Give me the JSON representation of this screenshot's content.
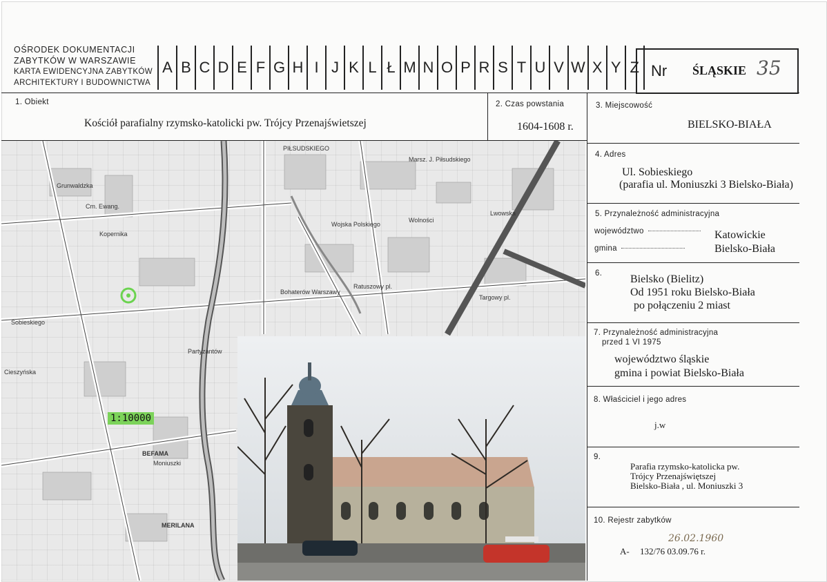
{
  "header": {
    "institution_lines": [
      "OŚRODEK DOKUMENTACJI",
      "ZABYTKÓW W WARSZAWIE",
      "KARTA EWIDENCYJNA ZABYTKÓW",
      "ARCHITEKTURY I BUDOWNICTWA"
    ],
    "letters": [
      "A",
      "B",
      "C",
      "D",
      "E",
      "F",
      "G",
      "H",
      "I",
      "J",
      "K",
      "L",
      "Ł",
      "M",
      "N",
      "O",
      "P",
      "R",
      "S",
      "T",
      "U",
      "V",
      "W",
      "X",
      "Y",
      "Z"
    ],
    "nr_label": "Nr",
    "register": "ŚLĄSKIE",
    "number": "35"
  },
  "fields": {
    "obiekt_label": "1. Obiekt",
    "obiekt_value": "Kościół parafialny rzymsko-katolicki pw. Trójcy Przenajświetszej",
    "czas_label": "2. Czas powstania",
    "czas_value": "1604-1608 r.",
    "miejscowosc_label": "3. Miejscowość",
    "miejscowosc_value": "BIELSKO-BIAŁA",
    "adres_label": "4. Adres",
    "adres_line1": "Ul. Sobieskiego",
    "adres_line2": "(parafia ul. Moniuszki 3 Bielsko-Biała)",
    "przynaleznosc_label": "5. Przynależność administracyjna",
    "wojewodztwo_label": "województwo",
    "wojewodztwo_value": "Katowickie",
    "gmina_label": "gmina",
    "gmina_value": "Bielsko-Biała",
    "f6_label": "6.",
    "f6_line1": "Bielsko (Bielitz)",
    "f6_line2": "Od 1951 roku Bielsko-Biała",
    "f6_line3": "po połączeniu 2 miast",
    "f7_label_line1": "7. Przynależność administracyjna",
    "f7_label_line2": "przed 1 VI 1975",
    "f7_line1": "województwo  śląskie",
    "f7_line2": "gmina i powiat Bielsko-Biała",
    "f8_label": "8. Właściciel i jego adres",
    "f8_value": "j.w",
    "f9_label": "9.",
    "f9_line1": "Parafia rzymsko-katolicka pw.",
    "f9_line2": "Trójcy Przenajświętszej",
    "f9_line3": "Bielsko-Biała , ul. Moniuszki 3",
    "f10_label": "10. Rejestr zabytków",
    "f10_handwritten": "26.02.1960",
    "f10_prefix": "A-",
    "f10_value": "132/76  03.09.76 r."
  },
  "map": {
    "scale": "1:10000",
    "labels": [
      "Cm. Ewang.",
      "PIŁSUDSKIEGO",
      "Marsz. J. Piłsudskiego",
      "Wolności",
      "Wojska Polskiego",
      "Bohaterów Warszawy",
      "Ratuszowy pl.",
      "Targowy pl.",
      "Lwowska",
      "Sobieskiego",
      "BEFAMA",
      "MERILANA",
      "Moniuszki",
      "Cieszyńska",
      "Grunwaldzka",
      "Kopernika",
      "Partyzantów"
    ]
  },
  "colors": {
    "ink": "#222222",
    "map_bg": "#e9e9e9",
    "scale_highlight": "#7cd35a",
    "marker": "#6bd34f",
    "handwriting": "#7a6a50"
  }
}
